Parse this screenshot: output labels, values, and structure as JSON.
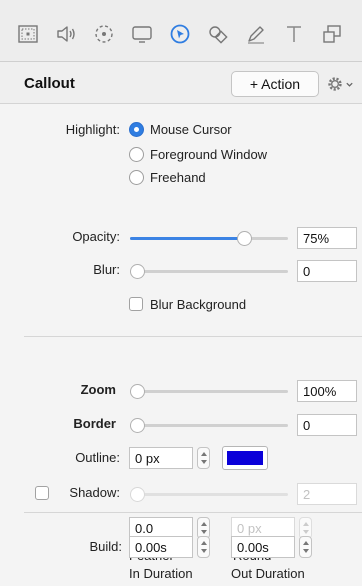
{
  "toolbar": {
    "tools": [
      {
        "icon": "canvas-icon"
      },
      {
        "icon": "audio-icon"
      },
      {
        "icon": "transition-icon"
      },
      {
        "icon": "screen-icon"
      },
      {
        "icon": "cursor-icon",
        "active": true
      },
      {
        "icon": "shapes-icon"
      },
      {
        "icon": "pen-icon"
      },
      {
        "icon": "text-icon"
      },
      {
        "icon": "media-icon"
      }
    ],
    "active_color": "#2f7de1"
  },
  "panel": {
    "title": "Callout",
    "action_label": "+ Action"
  },
  "highlight": {
    "label": "Highlight:",
    "options": [
      "Mouse Cursor",
      "Foreground Window",
      "Freehand"
    ],
    "selected": "Mouse Cursor"
  },
  "opacity": {
    "label": "Opacity:",
    "value": "75%",
    "fraction": 0.75
  },
  "blur": {
    "label": "Blur:",
    "value": "0",
    "fraction": 0.0
  },
  "blur_background": {
    "label": "Blur Background",
    "checked": false
  },
  "zoom": {
    "label": "Zoom",
    "value": "100%",
    "fraction": 0.0
  },
  "border": {
    "label": "Border",
    "value": "0",
    "fraction": 0.0
  },
  "outline": {
    "label": "Outline:",
    "value": "0 px",
    "color": "#0a00d9"
  },
  "shadow": {
    "label": "Shadow:",
    "value": "2",
    "checked": false
  },
  "feather": {
    "label": "Feather",
    "value": "0.0"
  },
  "round": {
    "label": "Round",
    "value": "0 px"
  },
  "build": {
    "label": "Build:",
    "in_value": "0.00s",
    "in_label": "In Duration",
    "out_value": "0.00s",
    "out_label": "Out Duration"
  }
}
